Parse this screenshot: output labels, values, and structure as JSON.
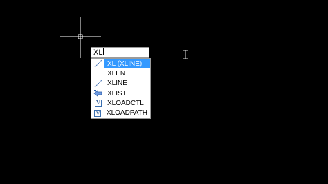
{
  "command_line": {
    "input_value": "XL"
  },
  "suggestions": [
    {
      "label": "XL (XLINE)",
      "icon": "xline-icon",
      "selected": true
    },
    {
      "label": "XLEN",
      "icon": "xline-icon",
      "selected": false
    },
    {
      "label": "XLINE",
      "icon": "xline-icon",
      "selected": false
    },
    {
      "label": "XLIST",
      "icon": "xlist-icon",
      "selected": false
    },
    {
      "label": "XLOADCTL",
      "icon": "xref-v-icon",
      "selected": false
    },
    {
      "label": "XLOADPATH",
      "icon": "xref-v-icon",
      "selected": false
    }
  ],
  "colors": {
    "canvas_background": "#000000",
    "selection_highlight": "#3399ff",
    "crosshair": "#ffffff"
  },
  "icon_glyphs": {
    "xref_v": "V"
  }
}
